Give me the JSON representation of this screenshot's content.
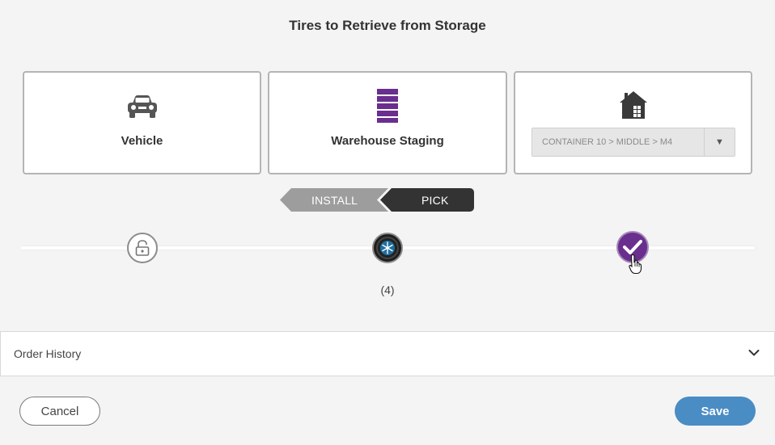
{
  "dialog": {
    "title": "Tires to Retrieve from Storage"
  },
  "cards": {
    "vehicle": {
      "label": "Vehicle",
      "icon": "car-icon"
    },
    "staging": {
      "label": "Warehouse Staging",
      "icon": "warehouse-rack-icon"
    },
    "location": {
      "icon": "warehouse-building-icon",
      "select_value": "CONTAINER 10 > MIDDLE > M4"
    }
  },
  "segments": {
    "install": "INSTALL",
    "pick": "PICK",
    "active": "PICK"
  },
  "progress": {
    "steps": [
      {
        "icon": "unlock-icon"
      },
      {
        "icon": "tire-snowflake-icon"
      },
      {
        "icon": "checkmark-icon"
      }
    ],
    "count": "(4)"
  },
  "order_history": {
    "label": "Order History",
    "icon": "chevron-down-icon"
  },
  "footer": {
    "cancel_label": "Cancel",
    "save_label": "Save"
  },
  "colors": {
    "accent_purple": "#6a2e8e",
    "primary_blue": "#4a8cc4",
    "dark": "#333333",
    "muted_gray": "#9d9d9d"
  }
}
